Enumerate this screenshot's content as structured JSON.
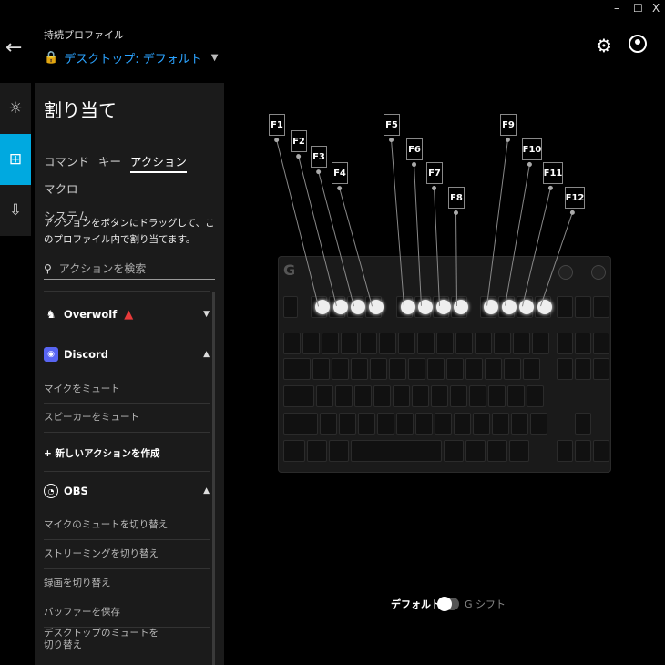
{
  "window": {
    "minimize": "–",
    "maximize": "☐",
    "close": "X"
  },
  "header": {
    "profile_label": "持続プロファイル",
    "profile_value": "デスクトップ: デフォルト"
  },
  "panel": {
    "title": "割り当て",
    "tabs": [
      "コマンド",
      "キー",
      "アクション",
      "マクロ",
      "システム"
    ],
    "active_tab": "アクション",
    "instructions": "アクションをボタンにドラッグして、このプロファイル内で割り当てます。",
    "search_placeholder": "アクションを検索",
    "groups": [
      {
        "name": "Overwolf",
        "expanded": false,
        "actions": []
      },
      {
        "name": "Discord",
        "expanded": true,
        "actions": [
          "マイクをミュート",
          "スピーカーをミュート"
        ],
        "new_action": "新しいアクションを作成"
      },
      {
        "name": "OBS",
        "expanded": true,
        "actions": [
          "マイクのミュートを切り替え",
          "ストリーミングを切り替え",
          "録画を切り替え",
          "バッファーを保存",
          "デスクトップのミュートを切り替え"
        ]
      }
    ]
  },
  "keyboard": {
    "fkeys": [
      "F1",
      "F2",
      "F3",
      "F4",
      "F5",
      "F6",
      "F7",
      "F8",
      "F9",
      "F10",
      "F11",
      "F12"
    ]
  },
  "toggle": {
    "left_label": "デフォルト",
    "right_label": "G シフト"
  }
}
